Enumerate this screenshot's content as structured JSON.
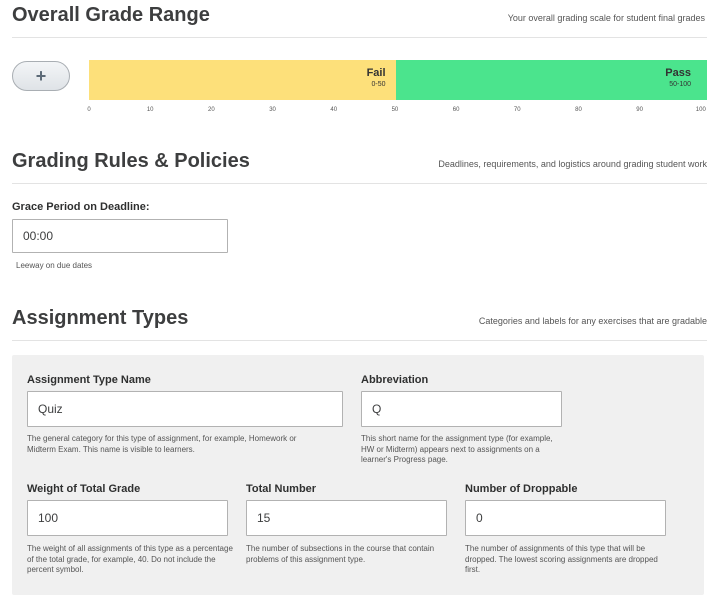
{
  "grade_range": {
    "title": "Overall Grade Range",
    "subtitle": "Your overall grading scale for student final grades",
    "add_button_label": "+",
    "segments": [
      {
        "name": "Fail",
        "range": "0-50",
        "color": "#fde07a"
      },
      {
        "name": "Pass",
        "range": "50-100",
        "color": "#4be48d"
      }
    ],
    "axis_ticks": [
      "0",
      "10",
      "20",
      "30",
      "40",
      "50",
      "60",
      "70",
      "80",
      "90",
      "100"
    ]
  },
  "grading_rules": {
    "title": "Grading Rules & Policies",
    "subtitle": "Deadlines, requirements, and logistics around grading student work",
    "grace_period": {
      "label": "Grace Period on Deadline:",
      "value": "00:00",
      "help": "Leeway on due dates"
    }
  },
  "assignment_types": {
    "title": "Assignment Types",
    "subtitle": "Categories and labels for any exercises that are gradable",
    "type_name": {
      "label": "Assignment Type Name",
      "value": "Quiz",
      "help": "The general category for this type of assignment, for example, Homework or Midterm Exam. This name is visible to learners."
    },
    "abbreviation": {
      "label": "Abbreviation",
      "value": "Q",
      "help": "This short name for the assignment type (for example, HW or Midterm) appears next to assignments on a learner's Progress page."
    },
    "weight": {
      "label": "Weight of Total Grade",
      "value": "100",
      "help": "The weight of all assignments of this type as a percentage of the total grade, for example, 40. Do not include the percent symbol."
    },
    "total_number": {
      "label": "Total Number",
      "value": "15",
      "help": "The number of subsections in the course that contain problems of this assignment type."
    },
    "droppable": {
      "label": "Number of Droppable",
      "value": "0",
      "help": "The number of assignments of this type that will be dropped. The lowest scoring assignments are dropped first."
    }
  }
}
